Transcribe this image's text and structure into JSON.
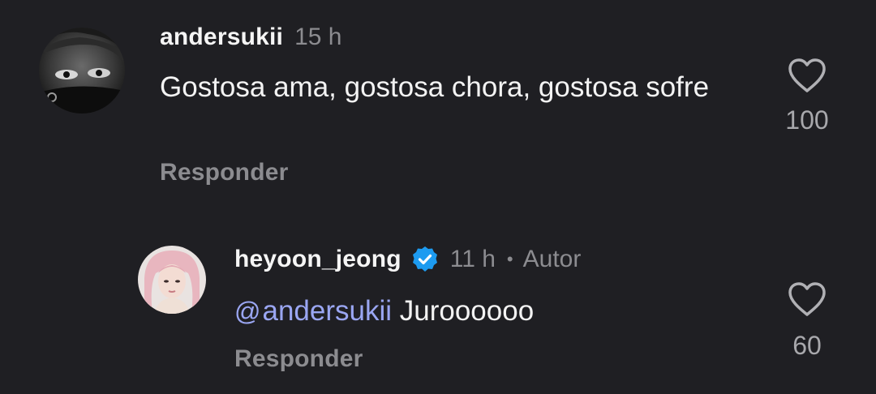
{
  "comments": [
    {
      "username": "andersukii",
      "time": "15 h",
      "text": "Gostosa ama, gostosa chora, gostosa sofre",
      "reply_label": "Responder",
      "likes": "100",
      "avatar": "dark-face-avatar"
    },
    {
      "username": "heyoon_jeong",
      "verified": true,
      "time": "11 h",
      "separator": "•",
      "author_label": "Autor",
      "mention": "andersukii",
      "text": " Juroooooo",
      "reply_label": "Responder",
      "likes": "60",
      "avatar": "pink-hair-avatar"
    }
  ],
  "colors": {
    "background": "#1f1f23",
    "muted": "#8c8c90",
    "mention": "#9aa6f2",
    "verified": "#1d9bf0"
  }
}
